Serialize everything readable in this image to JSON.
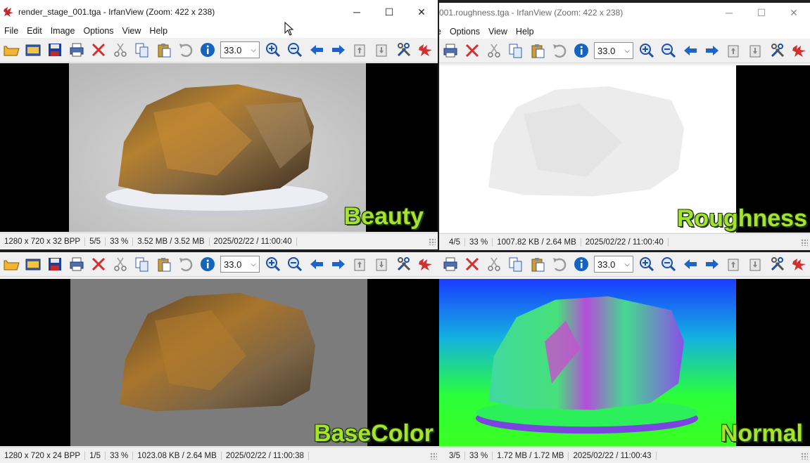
{
  "windows": {
    "beauty": {
      "title": "render_stage_001.tga - IrfanView (Zoom: 422 x 238)",
      "menu": [
        "File",
        "Edit",
        "Image",
        "Options",
        "View",
        "Help"
      ],
      "zoom": "33.0",
      "overlay": "Beauty",
      "status": [
        "1280 x 720 x 32 BPP",
        "5/5",
        "33 %",
        "3.52 MB / 3.52 MB",
        "2025/02/22 / 11:00:40"
      ]
    },
    "roughness": {
      "title": "001.roughness.tga - IrfanView (Zoom: 422 x 238)",
      "menu": [
        "e",
        "Options",
        "View",
        "Help"
      ],
      "zoom": "33.0",
      "overlay": "Roughness",
      "status": [
        "4/5",
        "33 %",
        "1007.82 KB / 2.64 MB",
        "2025/02/22 / 11:00:40"
      ]
    },
    "basecolor": {
      "zoom": "33.0",
      "overlay": "BaseColor",
      "status": [
        "1280 x 720 x 24 BPP",
        "1/5",
        "33 %",
        "1023.08 KB / 2.64 MB",
        "2025/02/22 / 11:00:38"
      ]
    },
    "normal": {
      "zoom": "33.0",
      "overlay": "Normal",
      "status": [
        "3/5",
        "33 %",
        "1.72 MB / 1.72 MB",
        "2025/02/22 / 11:00:43"
      ]
    }
  },
  "caption_buttons": {
    "minimize": "─",
    "maximize": "☐",
    "close": "✕"
  },
  "toolbar_icons": [
    "open-folder-icon",
    "slideshow-icon",
    "save-icon",
    "print-icon",
    "delete-icon",
    "cut-icon",
    "copy-icon",
    "paste-icon",
    "undo-icon",
    "info-icon",
    "zoom-select",
    "zoom-in-icon",
    "zoom-out-icon",
    "previous-icon",
    "next-icon",
    "first-page-icon",
    "last-page-icon",
    "settings-icon",
    "exit-icon"
  ],
  "colors": {
    "overlay_text": "#a6e22e",
    "info_blue": "#1565c0",
    "delete_red": "#d32f2f"
  }
}
